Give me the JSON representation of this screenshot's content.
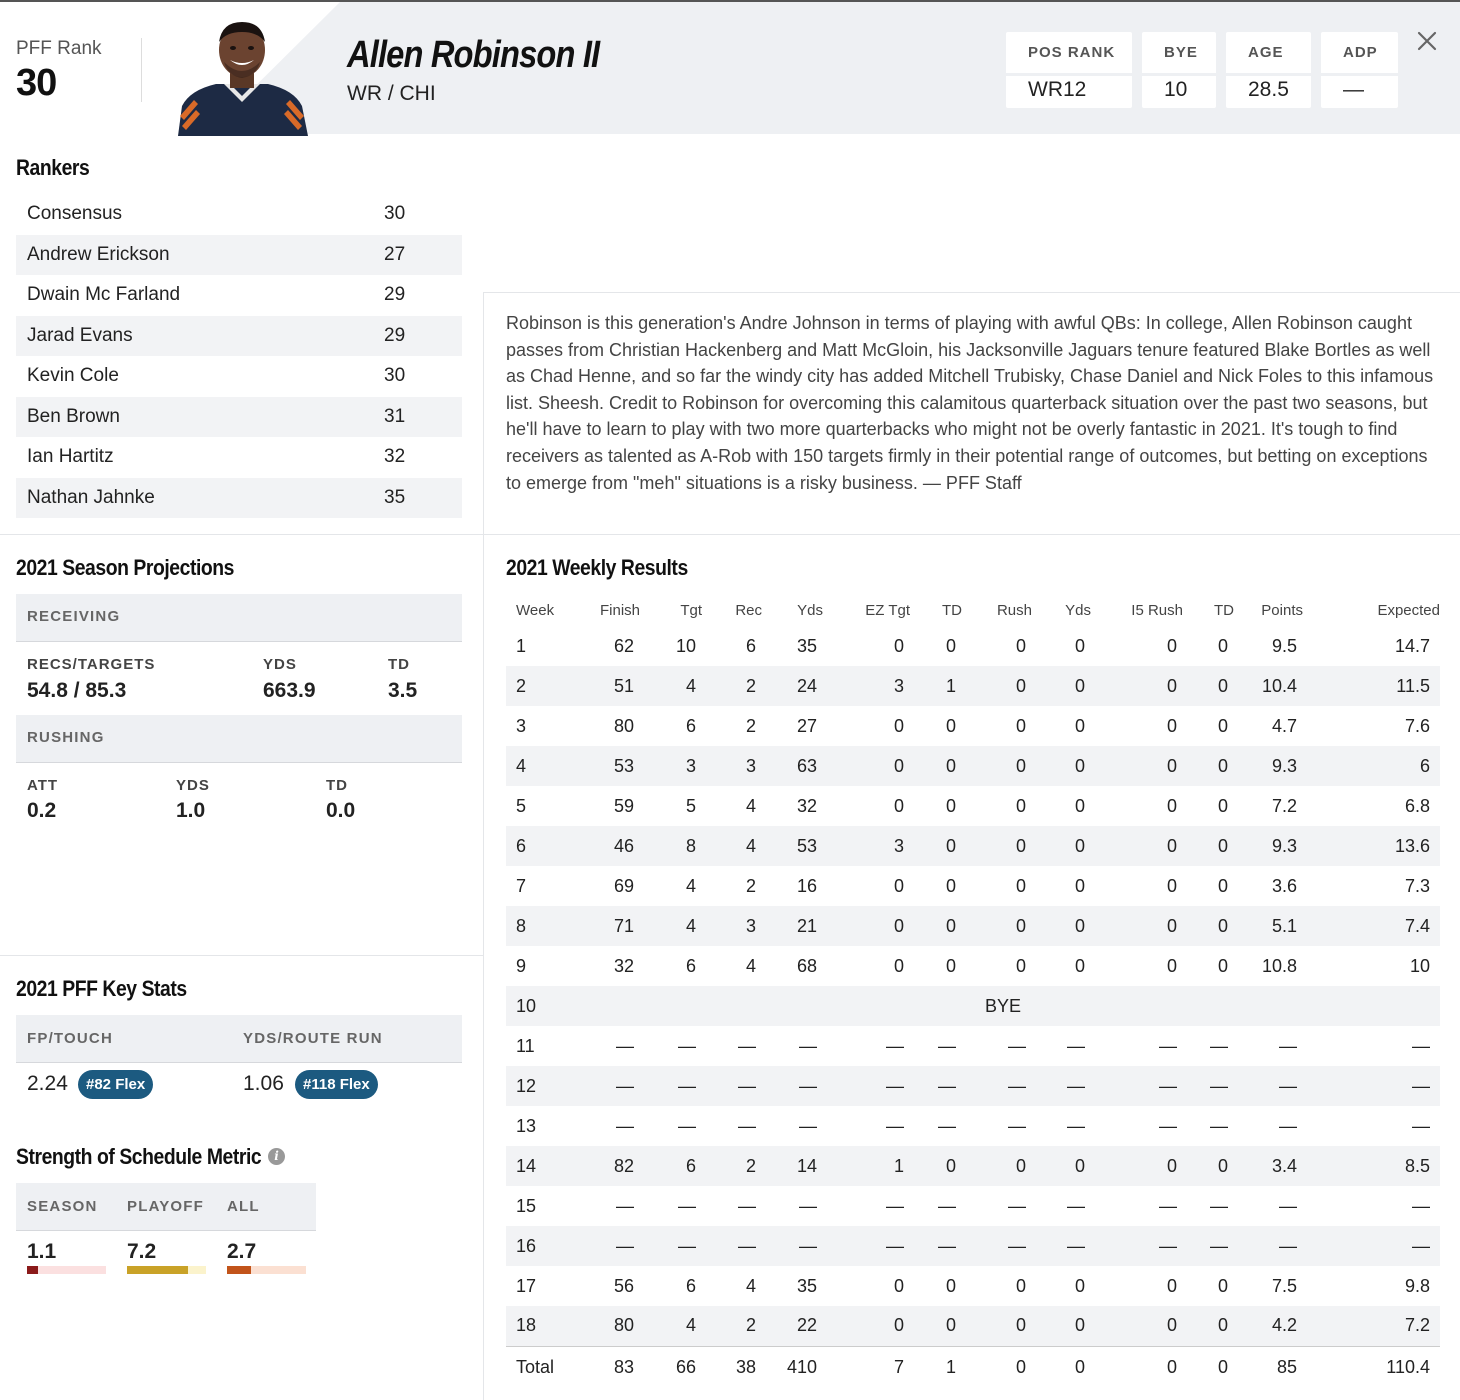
{
  "header": {
    "pff_rank_label": "PFF Rank",
    "pff_rank_value": "30",
    "player_name": "Allen Robinson II",
    "player_pos_team": "WR / CHI",
    "stats": [
      {
        "label": "POS RANK",
        "value": "WR12"
      },
      {
        "label": "BYE",
        "value": "10"
      },
      {
        "label": "AGE",
        "value": "28.5"
      },
      {
        "label": "ADP",
        "value": "—"
      }
    ],
    "close_icon": "close-icon"
  },
  "rankers": {
    "title": "Rankers",
    "rows": [
      {
        "name": "Consensus",
        "rank": "30"
      },
      {
        "name": "Andrew Erickson",
        "rank": "27"
      },
      {
        "name": "Dwain Mc Farland",
        "rank": "29"
      },
      {
        "name": "Jarad Evans",
        "rank": "29"
      },
      {
        "name": "Kevin Cole",
        "rank": "30"
      },
      {
        "name": "Ben Brown",
        "rank": "31"
      },
      {
        "name": "Ian Hartitz",
        "rank": "32"
      },
      {
        "name": "Nathan Jahnke",
        "rank": "35"
      }
    ]
  },
  "projections": {
    "title": "2021 Season Projections",
    "receiving_label": "RECEIVING",
    "receiving": {
      "recs_targets_label": "RECS/TARGETS",
      "recs_targets": "54.8 / 85.3",
      "yds_label": "YDS",
      "yds": "663.9",
      "td_label": "TD",
      "td": "3.5"
    },
    "rushing_label": "RUSHING",
    "rushing": {
      "att_label": "ATT",
      "att": "0.2",
      "yds_label": "YDS",
      "yds": "1.0",
      "td_label": "TD",
      "td": "0.0"
    }
  },
  "key_stats": {
    "title": "2021 PFF Key Stats",
    "fp_touch_label": "FP/TOUCH",
    "fp_touch_value": "2.24",
    "fp_touch_badge": "#82 Flex",
    "yprr_label": "YDS/ROUTE RUN",
    "yprr_value": "1.06",
    "yprr_badge": "#118 Flex",
    "badge_color": "#1c5a80"
  },
  "sos": {
    "title": "Strength of Schedule Metric",
    "info_icon": "info-icon",
    "columns": [
      {
        "label": "SEASON",
        "value": "1.1",
        "fill": 0.14,
        "color": "#8b1a1a",
        "track": "#fbe0e0"
      },
      {
        "label": "PLAYOFF",
        "value": "7.2",
        "fill": 0.77,
        "color": "#c9a227",
        "track": "#fbf3cc"
      },
      {
        "label": "ALL",
        "value": "2.7",
        "fill": 0.3,
        "color": "#c2541a",
        "track": "#fbe0d2"
      }
    ]
  },
  "description": "Robinson is this generation's Andre Johnson in terms of playing with awful QBs: In college, Allen Robinson caught passes from Christian Hackenberg and Matt McGloin, his Jacksonville Jaguars tenure featured Blake Bortles as well as Chad Henne, and so far the windy city has added Mitchell Trubisky, Chase Daniel and Nick Foles to this infamous list. Sheesh. Credit to Robinson for overcoming this calamitous quarterback situation over the past two seasons, but he'll have to learn to play with two more quarterbacks who might not be overly fantastic in 2021. It's tough to find receivers as talented as A-Rob with 150 targets firmly in their potential range of outcomes, but betting on exceptions to emerge from \"meh\" situations is a risky business. — PFF Staff",
  "weekly": {
    "title": "2021 Weekly Results",
    "columns": [
      "Week",
      "Finish",
      "Tgt",
      "Rec",
      "Yds",
      "EZ Tgt",
      "TD",
      "Rush",
      "Yds",
      "I5 Rush",
      "TD",
      "Points",
      "Expected"
    ],
    "rows": [
      [
        "1",
        "62",
        "10",
        "6",
        "35",
        "0",
        "0",
        "0",
        "0",
        "0",
        "0",
        "9.5",
        "14.7"
      ],
      [
        "2",
        "51",
        "4",
        "2",
        "24",
        "3",
        "1",
        "0",
        "0",
        "0",
        "0",
        "10.4",
        "11.5"
      ],
      [
        "3",
        "80",
        "6",
        "2",
        "27",
        "0",
        "0",
        "0",
        "0",
        "0",
        "0",
        "4.7",
        "7.6"
      ],
      [
        "4",
        "53",
        "3",
        "3",
        "63",
        "0",
        "0",
        "0",
        "0",
        "0",
        "0",
        "9.3",
        "6"
      ],
      [
        "5",
        "59",
        "5",
        "4",
        "32",
        "0",
        "0",
        "0",
        "0",
        "0",
        "0",
        "7.2",
        "6.8"
      ],
      [
        "6",
        "46",
        "8",
        "4",
        "53",
        "3",
        "0",
        "0",
        "0",
        "0",
        "0",
        "9.3",
        "13.6"
      ],
      [
        "7",
        "69",
        "4",
        "2",
        "16",
        "0",
        "0",
        "0",
        "0",
        "0",
        "0",
        "3.6",
        "7.3"
      ],
      [
        "8",
        "71",
        "4",
        "3",
        "21",
        "0",
        "0",
        "0",
        "0",
        "0",
        "0",
        "5.1",
        "7.4"
      ],
      [
        "9",
        "32",
        "6",
        "4",
        "68",
        "0",
        "0",
        "0",
        "0",
        "0",
        "0",
        "10.8",
        "10"
      ],
      [
        "10",
        "BYE"
      ],
      [
        "11",
        "—",
        "—",
        "—",
        "—",
        "—",
        "—",
        "—",
        "—",
        "—",
        "—",
        "—",
        "—"
      ],
      [
        "12",
        "—",
        "—",
        "—",
        "—",
        "—",
        "—",
        "—",
        "—",
        "—",
        "—",
        "—",
        "—"
      ],
      [
        "13",
        "—",
        "—",
        "—",
        "—",
        "—",
        "—",
        "—",
        "—",
        "—",
        "—",
        "—",
        "—"
      ],
      [
        "14",
        "82",
        "6",
        "2",
        "14",
        "1",
        "0",
        "0",
        "0",
        "0",
        "0",
        "3.4",
        "8.5"
      ],
      [
        "15",
        "—",
        "—",
        "—",
        "—",
        "—",
        "—",
        "—",
        "—",
        "—",
        "—",
        "—",
        "—"
      ],
      [
        "16",
        "—",
        "—",
        "—",
        "—",
        "—",
        "—",
        "—",
        "—",
        "—",
        "—",
        "—",
        "—"
      ],
      [
        "17",
        "56",
        "6",
        "4",
        "35",
        "0",
        "0",
        "0",
        "0",
        "0",
        "0",
        "7.5",
        "9.8"
      ],
      [
        "18",
        "80",
        "4",
        "2",
        "22",
        "0",
        "0",
        "0",
        "0",
        "0",
        "0",
        "4.2",
        "7.2"
      ]
    ],
    "total": [
      "Total",
      "83",
      "66",
      "38",
      "410",
      "7",
      "1",
      "0",
      "0",
      "0",
      "0",
      "85",
      "110.4"
    ]
  }
}
